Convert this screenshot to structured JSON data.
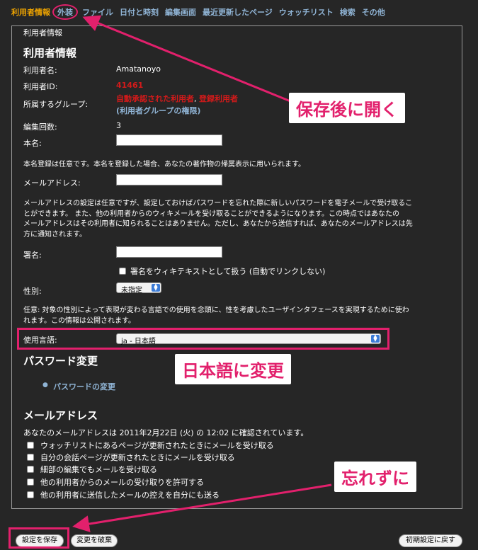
{
  "tabs": [
    "利用者情報",
    "外装",
    "ファイル",
    "日付と時刻",
    "編集画面",
    "最近更新したページ",
    "ウォッチリスト",
    "検索",
    "その他"
  ],
  "panel": {
    "legend": "利用者情報",
    "section_title": "利用者情報",
    "username_label": "利用者名:",
    "username_value": "Amatanoyo",
    "userid_label": "利用者ID:",
    "userid_value": "41461",
    "groups_label": "所属するグループ:",
    "group1": "自動承認された利用者",
    "group_sep": ",",
    "group2": "登録利用者",
    "group_rights": "(利用者グループの権限)",
    "editcount_label": "編集回数:",
    "editcount_value": "3",
    "realname_label": "本名:",
    "realname_note": "本名登録は任意です。本名を登録した場合、あなたの著作物の帰属表示に用いられます。",
    "email_label": "メールアドレス:",
    "email_note": [
      "メールアドレスの設定は任意ですが、設定しておけばパスワードを忘れた際に新しいパスワードを電子メールで受け取るこ",
      "とができます。 また、他の利用者からのウィキメールを受け取ることができるようになります。この時点ではあなたの",
      "メールアドレスはその利用者に知られることはありません。ただし、あなたから送信すれば、あなたのメールアドレスは先",
      "方に通知されます。"
    ],
    "signature_label": "署名:",
    "signature_checkbox": "署名をウィキテキストとして扱う (自動でリンクしない)",
    "gender_label": "性別:",
    "gender_value": "未指定",
    "gender_note": [
      "任意: 対象の性別によって表現が変わる言語での使用を念頭に、性を考慮したユーザインタフェースを実現するために使わ",
      "れます。この情報は公開されます。"
    ],
    "language_label": "使用言語:",
    "language_value": "ja - 日本語",
    "password_title": "パスワード変更",
    "password_link": "パスワードの変更",
    "email_section_title": "メールアドレス",
    "email_confirmed": "あなたのメールアドレスは 2011年2月22日 (火) の 12:02 に確認されています。",
    "email_options": [
      "ウォッチリストにあるページが更新されたときにメールを受け取る",
      "自分の会話ページが更新されたときにメールを受け取る",
      "細部の編集でもメールを受け取る",
      "他の利用者からのメールの受け取りを許可する",
      "他の利用者に送信したメールの控えを自分にも送る"
    ]
  },
  "buttons": {
    "save": "設定を保存",
    "discard": "変更を破棄",
    "reset": "初期設定に戻す"
  },
  "annotations": {
    "open_after_save": "保存後に開く",
    "change_to_japanese": "日本語に変更",
    "dont_forget": "忘れずに"
  },
  "colors": {
    "accent": "#e2206c",
    "active_tab": "#f0a500",
    "link": "#8fb3d4",
    "group_red": "#d41a1a"
  }
}
